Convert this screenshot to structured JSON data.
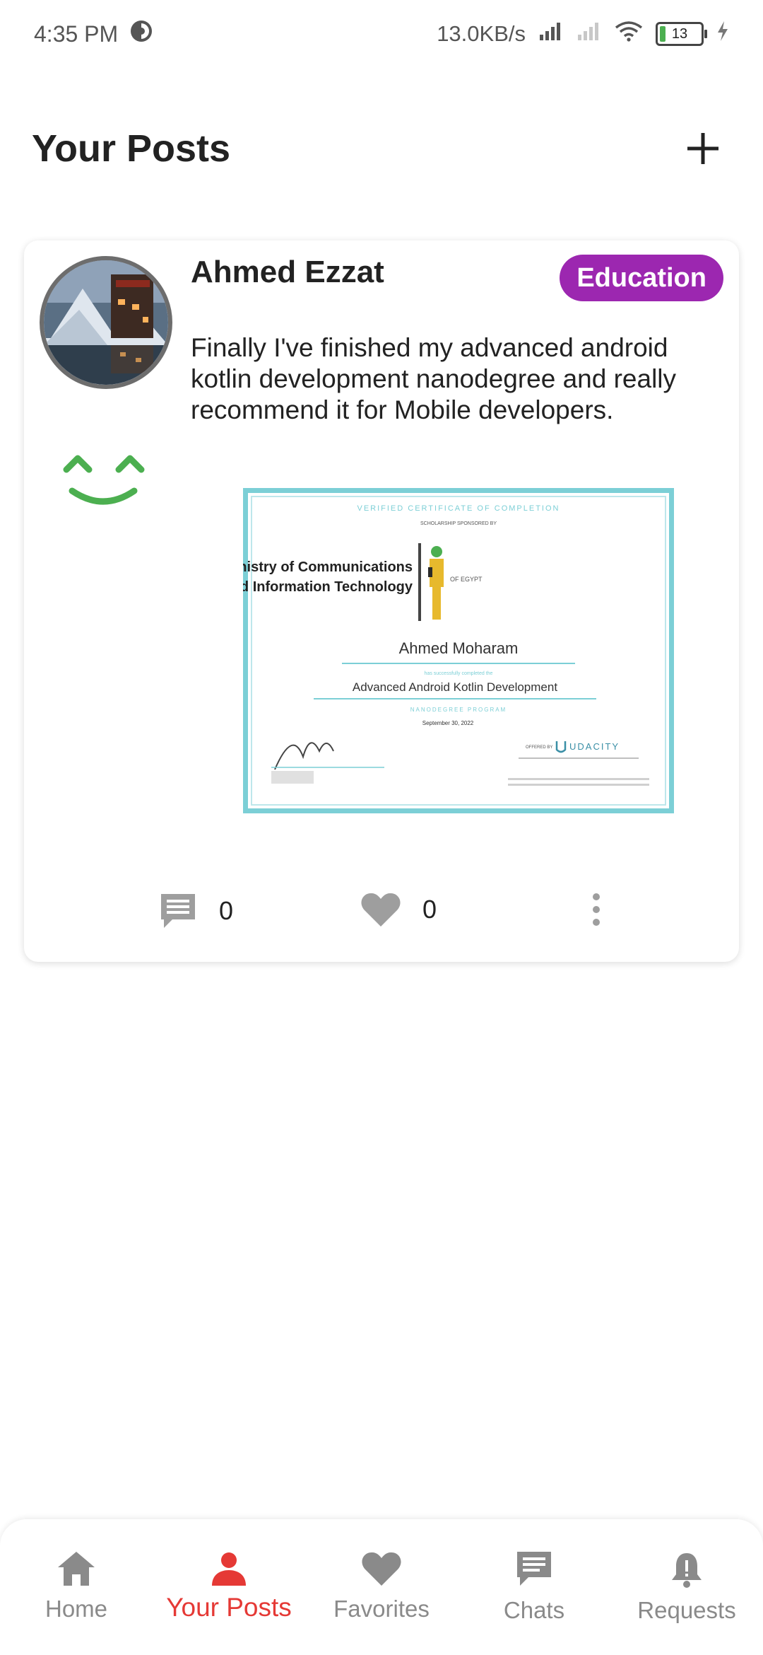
{
  "status": {
    "time": "4:35 PM",
    "net_speed": "13.0KB/s",
    "battery": "13"
  },
  "header": {
    "title": "Your Posts",
    "add_icon": "plus-icon"
  },
  "post": {
    "author": "Ahmed Ezzat",
    "category": "Education",
    "text": "Finally I've finished my advanced android kotlin development nanodegree and really recommend it for Mobile developers.",
    "comments_count": "0",
    "likes_count": "0",
    "certificate": {
      "heading": "VERIFIED CERTIFICATE OF COMPLETION",
      "sponsored": "SCHOLARSHIP SPONSORED BY",
      "ministry_line1": "Ministry of Communications",
      "ministry_line2": "and Information Technology",
      "country": "OF EGYPT",
      "recipient": "Ahmed Moharam",
      "completed": "has successfully completed the",
      "program": "Advanced Android Kotlin Development",
      "program_type": "NANODEGREE PROGRAM",
      "date": "September 30, 2022",
      "offered_by": "OFFERED BY",
      "provider": "UDACITY"
    }
  },
  "nav": {
    "items": [
      {
        "label": "Home",
        "icon": "home-icon"
      },
      {
        "label": "Your Posts",
        "icon": "person-icon"
      },
      {
        "label": "Favorites",
        "icon": "heart-icon"
      },
      {
        "label": "Chats",
        "icon": "chat-icon"
      },
      {
        "label": "Requests",
        "icon": "bell-icon"
      }
    ],
    "active": "Your Posts"
  },
  "colors": {
    "accent": "#e53935",
    "badge": "#9c27b0",
    "emoji": "#4caf50",
    "certificate_border": "#7ccfd6",
    "icon_gray": "#9e9e9e"
  }
}
